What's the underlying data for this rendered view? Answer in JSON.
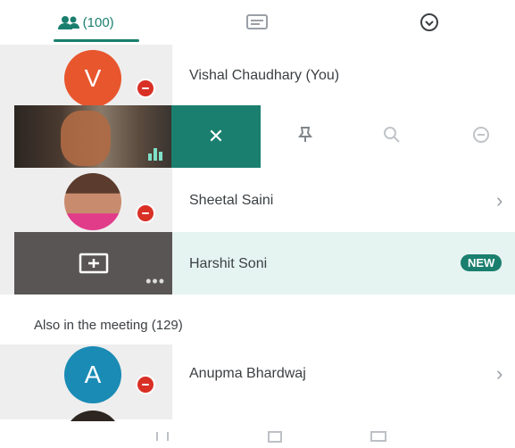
{
  "tabs": [
    {
      "label": "(100)",
      "icon": "people-icon",
      "active": true
    },
    {
      "label": "",
      "icon": "chat-icon",
      "active": false
    },
    {
      "label": "",
      "icon": "info-icon",
      "active": false
    }
  ],
  "participants": [
    {
      "name": "Vishal Chaudhary (You)",
      "initial": "V",
      "avatar_color": "#e8562e",
      "muted": true
    },
    {
      "name": "",
      "video_active": true,
      "pinned_actions": [
        "close",
        "pin",
        "zoom",
        "remove"
      ]
    },
    {
      "name": "Sheetal Saini",
      "muted": true
    },
    {
      "name": "Harshit Soni",
      "presenting": true,
      "new_label": "NEW"
    }
  ],
  "section": {
    "title": "Also in the meeting (129)"
  },
  "more_participants": [
    {
      "name": "Anupma Bhardwaj",
      "initial": "A",
      "avatar_color": "#1a8bb5",
      "muted": true
    }
  ],
  "colors": {
    "accent": "#1a7f6e",
    "muted_badge": "#d93025"
  }
}
